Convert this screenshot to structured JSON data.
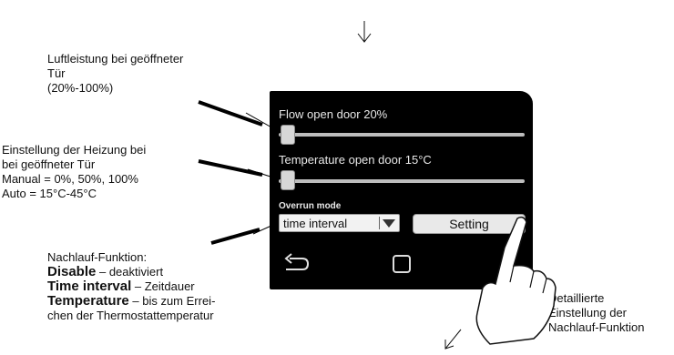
{
  "annotations": {
    "flow_title_line1": "Luftleistung bei geöffneter",
    "flow_title_line2": "Tür",
    "flow_title_line3": "(20%-100%)",
    "heat_line1": "Einstellung der Heizung bei",
    "heat_line2": "bei geöffneter Tür",
    "heat_line3": "Manual = 0%, 50%, 100%",
    "heat_line4": "Auto = 15°C-45°C",
    "overrun_title": "Nachlauf-Funktion:",
    "overrun_disable_term": "Disable",
    "overrun_disable_desc": " – deaktiviert",
    "overrun_time_term": "Time interval",
    "overrun_time_desc": " – Zeitdauer",
    "overrun_temp_term": "Temperature",
    "overrun_temp_desc": " – bis zum Errei-",
    "overrun_temp_desc2": "chen der Thermostattemperatur",
    "detail_line1": "Detaillierte",
    "detail_line2": "Einstellung der",
    "detail_line3": "Nachlauf-Funktion"
  },
  "screen": {
    "flow_label": "Flow open door 20%",
    "flow_level": 0.0,
    "temp_label": "Temperature open door 15°C",
    "temp_level": 0.0,
    "overrun_label": "Overrun mode",
    "overrun_value": "time interval",
    "setting_button": "Setting",
    "back_icon": "back-arrow-icon",
    "home_icon": "square-home-icon"
  },
  "colors": {
    "screen_bg": "#000000",
    "control_bg": "#e9e9e9"
  }
}
